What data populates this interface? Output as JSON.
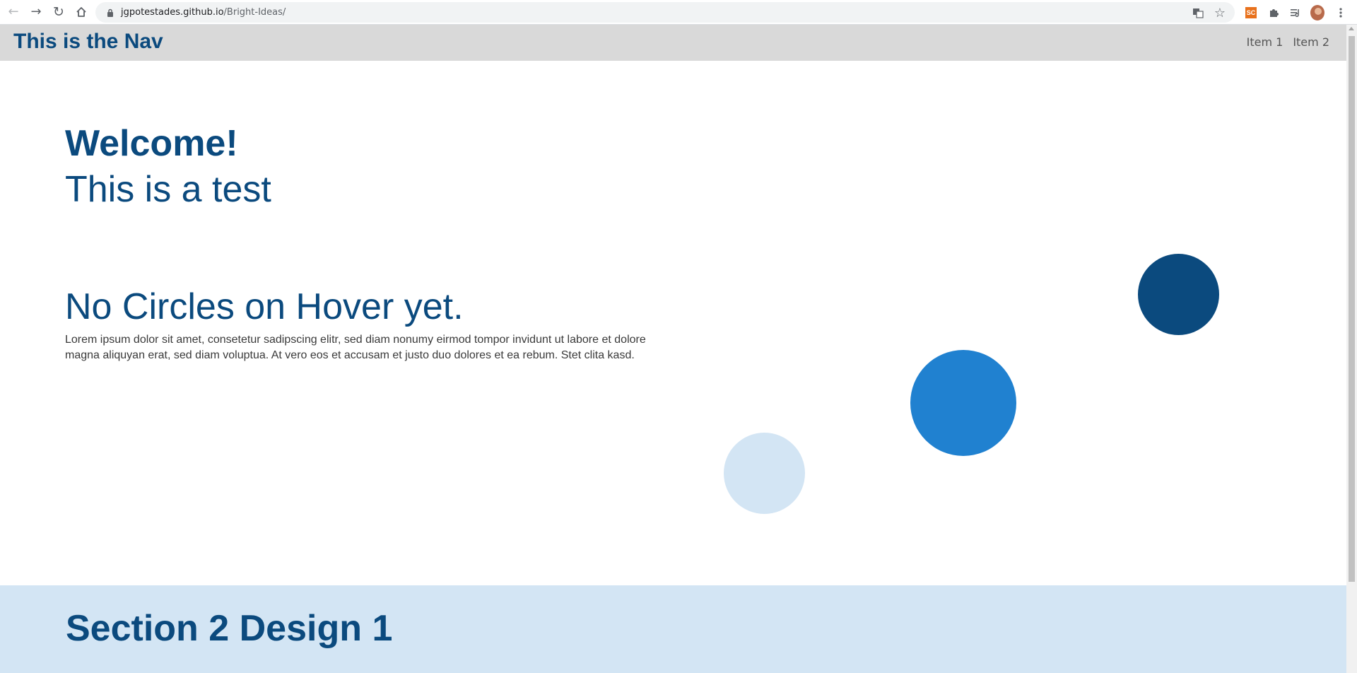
{
  "browser": {
    "url_host": "jgpotestades.github.io",
    "url_path": "/Bright-Ideas/",
    "icons": [
      "back-icon",
      "forward-icon",
      "reload-icon",
      "home-icon",
      "lock-icon",
      "translate-icon",
      "star-icon",
      "extension-sc-icon",
      "puzzle-icon",
      "media-control-icon",
      "avatar",
      "kebab-menu-icon"
    ],
    "extension_badge": "SC"
  },
  "nav": {
    "title": "This is the Nav",
    "items": [
      {
        "label": "Item 1"
      },
      {
        "label": "Item 2"
      }
    ]
  },
  "hero": {
    "heading": "Welcome!",
    "subheading": "This is a test"
  },
  "content": {
    "heading": "No Circles on Hover yet.",
    "body": "Lorem ipsum dolor sit amet, consetetur sadipscing elitr, sed diam nonumy eirmod tompor invidunt ut labore et dolore magna aliquyan erat, sed diam voluptua. At vero eos et accusam et justo duo dolores et ea rebum. Stet clita kasd."
  },
  "section2": {
    "title": "Section 2 Design 1"
  },
  "colors": {
    "primary": "#0b4a7e",
    "accent": "#2081d0",
    "light": "#d3e5f4",
    "nav_bg": "#d9d9d9"
  }
}
